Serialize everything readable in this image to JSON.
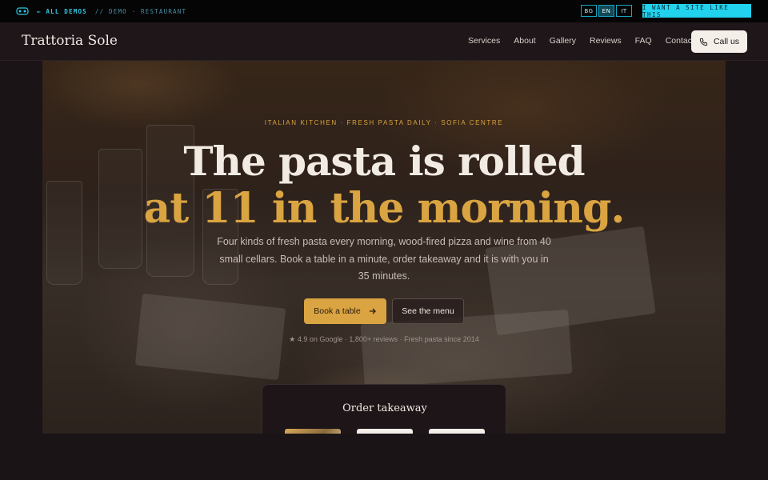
{
  "demo_bar": {
    "back_label": "← ALL DEMOS",
    "crumb": "// DEMO · RESTAURANT",
    "languages": [
      "BG",
      "EN",
      "IT"
    ],
    "active_language": "EN",
    "cta": "I WANT A SITE LIKE THIS"
  },
  "nav": {
    "brand": "Trattoria Sole",
    "items": [
      "Services",
      "About",
      "Gallery",
      "Reviews",
      "FAQ",
      "Contact"
    ],
    "call_label": "Call us"
  },
  "hero": {
    "eyebrow": "ITALIAN KITCHEN · FRESH PASTA DAILY · SOFIA CENTRE",
    "headline_line1": "The pasta is rolled",
    "headline_line2": "at 11 in the morning.",
    "lede": "Four kinds of fresh pasta every morning, wood-fired pizza and wine from 40 small cellars. Book a table in a minute, order takeaway and it is with you in 35 minutes.",
    "primary_button": "Book a table",
    "secondary_button": "See the menu",
    "rating_line": "★ 4.9 on Google · 1,800+ reviews · Fresh pasta since 2014"
  },
  "takeaway": {
    "title": "Order takeaway"
  },
  "colors": {
    "accent": "#d9a441",
    "demo_accent": "#22d3ee",
    "background": "#1b1416"
  }
}
